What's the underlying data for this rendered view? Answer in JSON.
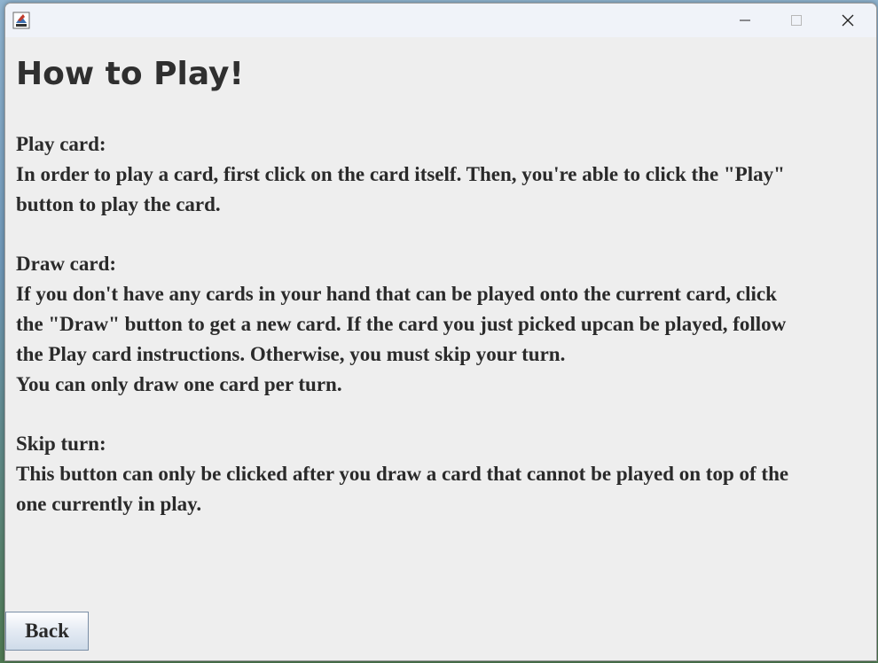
{
  "window": {
    "controls": {
      "minimize_icon": "minimize-icon",
      "maximize_icon": "maximize-icon",
      "close_icon": "close-icon"
    }
  },
  "heading": "How to Play!",
  "sections": [
    {
      "title": "Play card:",
      "lines": [
        "In order to play a card, first click on the card itself. Then, you're able to click the \"Play\"",
        "button to play the card."
      ]
    },
    {
      "title": "Draw card:",
      "lines": [
        "If you don't have any cards in your hand that can be played onto the current card, click",
        "the \"Draw\" button to get a new card. If the card you just picked upcan be played, follow",
        "the Play card instructions. Otherwise, you must skip your turn.",
        "You can only draw one card per turn."
      ]
    },
    {
      "title": "Skip turn:",
      "lines": [
        "This button can only be clicked after you draw a card that cannot be played on top of the",
        "one currently in play."
      ]
    }
  ],
  "back_button": "Back"
}
